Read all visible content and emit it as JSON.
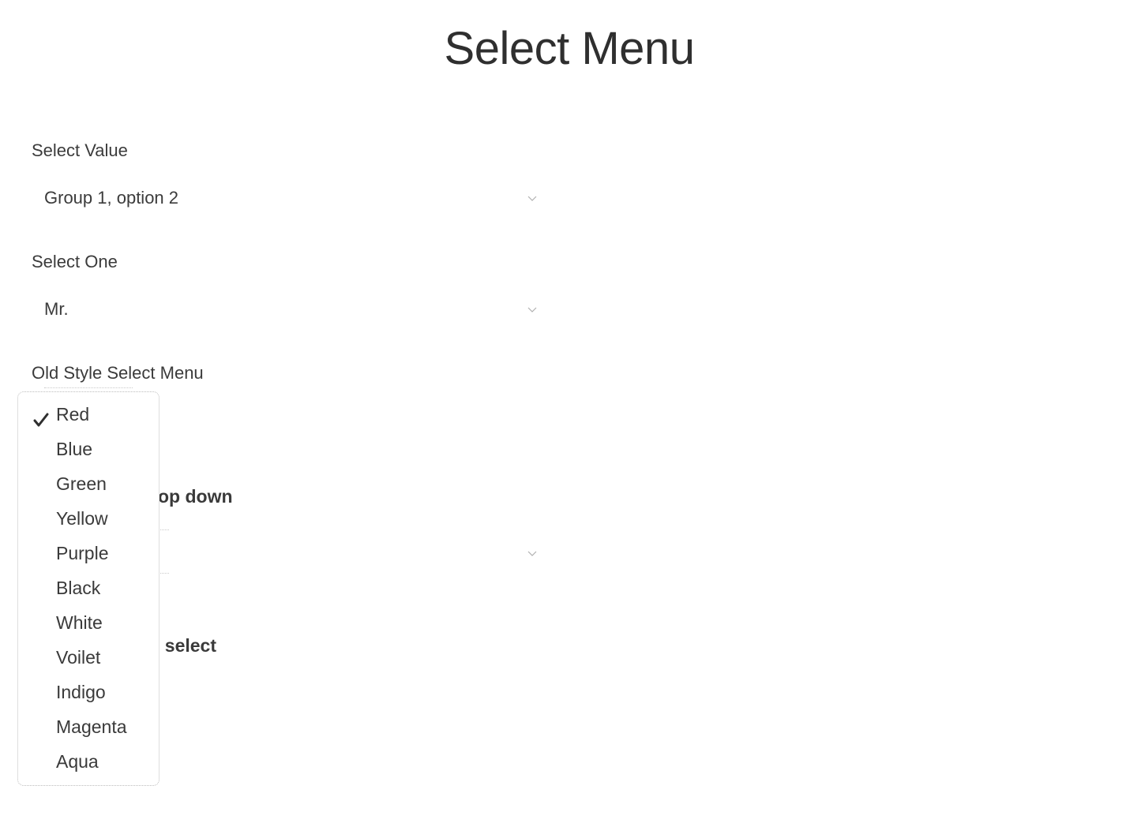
{
  "page": {
    "title": "Select Menu"
  },
  "select_value": {
    "label": "Select Value",
    "selected": "Group 1, option 2",
    "icon": "chevron-down-icon"
  },
  "select_one": {
    "label": "Select One",
    "selected": "Mr.",
    "icon": "chevron-down-icon"
  },
  "old_style": {
    "label": "Old Style Select Menu",
    "options": [
      "Red",
      "Blue",
      "Green",
      "Yellow",
      "Purple",
      "Black",
      "White",
      "Voilet",
      "Indigo",
      "Magenta",
      "Aqua"
    ],
    "selected": "Red",
    "check_icon": "checkmark-icon"
  },
  "hidden_labels": {
    "drop_down_fragment": "op down",
    "multi_select_fragment": "i select"
  },
  "colors": {
    "text": "#3a3a3a",
    "chevron": "#b0b0b0",
    "popup_border": "#bdbdbd"
  }
}
